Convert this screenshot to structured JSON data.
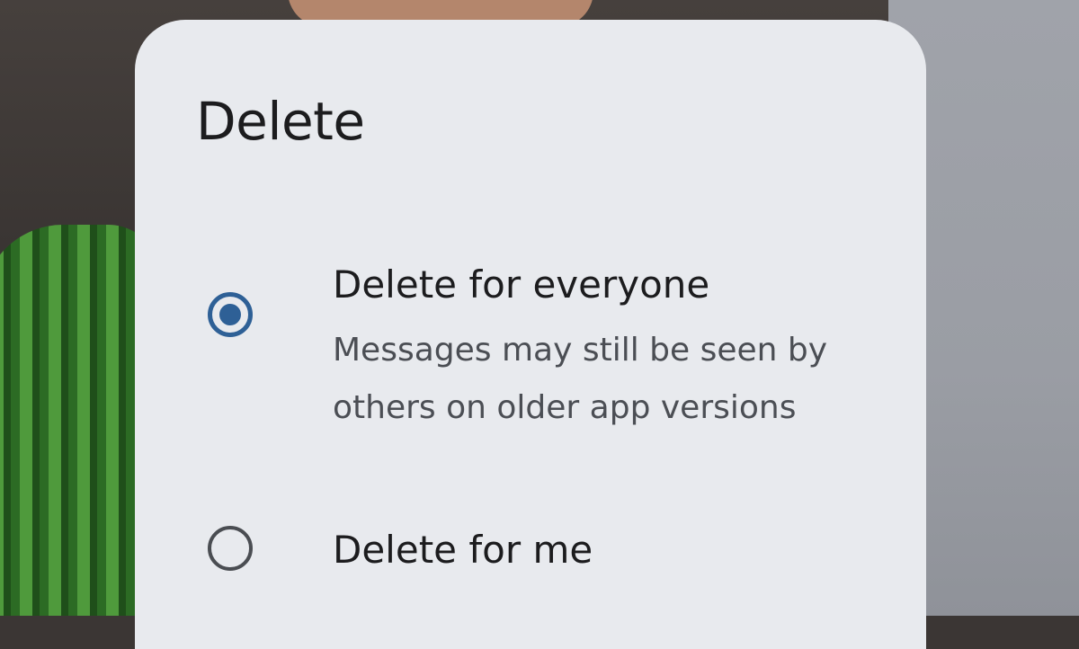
{
  "dialog": {
    "title": "Delete",
    "options": [
      {
        "label": "Delete for everyone",
        "description": "Messages may still be seen by others on older app versions",
        "selected": true
      },
      {
        "label": "Delete for me",
        "selected": false
      }
    ]
  },
  "colors": {
    "accent": "#2e6096",
    "dialog_background": "#e8eaee",
    "primary_text": "#1c1c1e",
    "secondary_text": "#4b4e54"
  },
  "icons": {
    "selected": "radio-selected-icon",
    "unselected": "radio-unselected-icon"
  }
}
